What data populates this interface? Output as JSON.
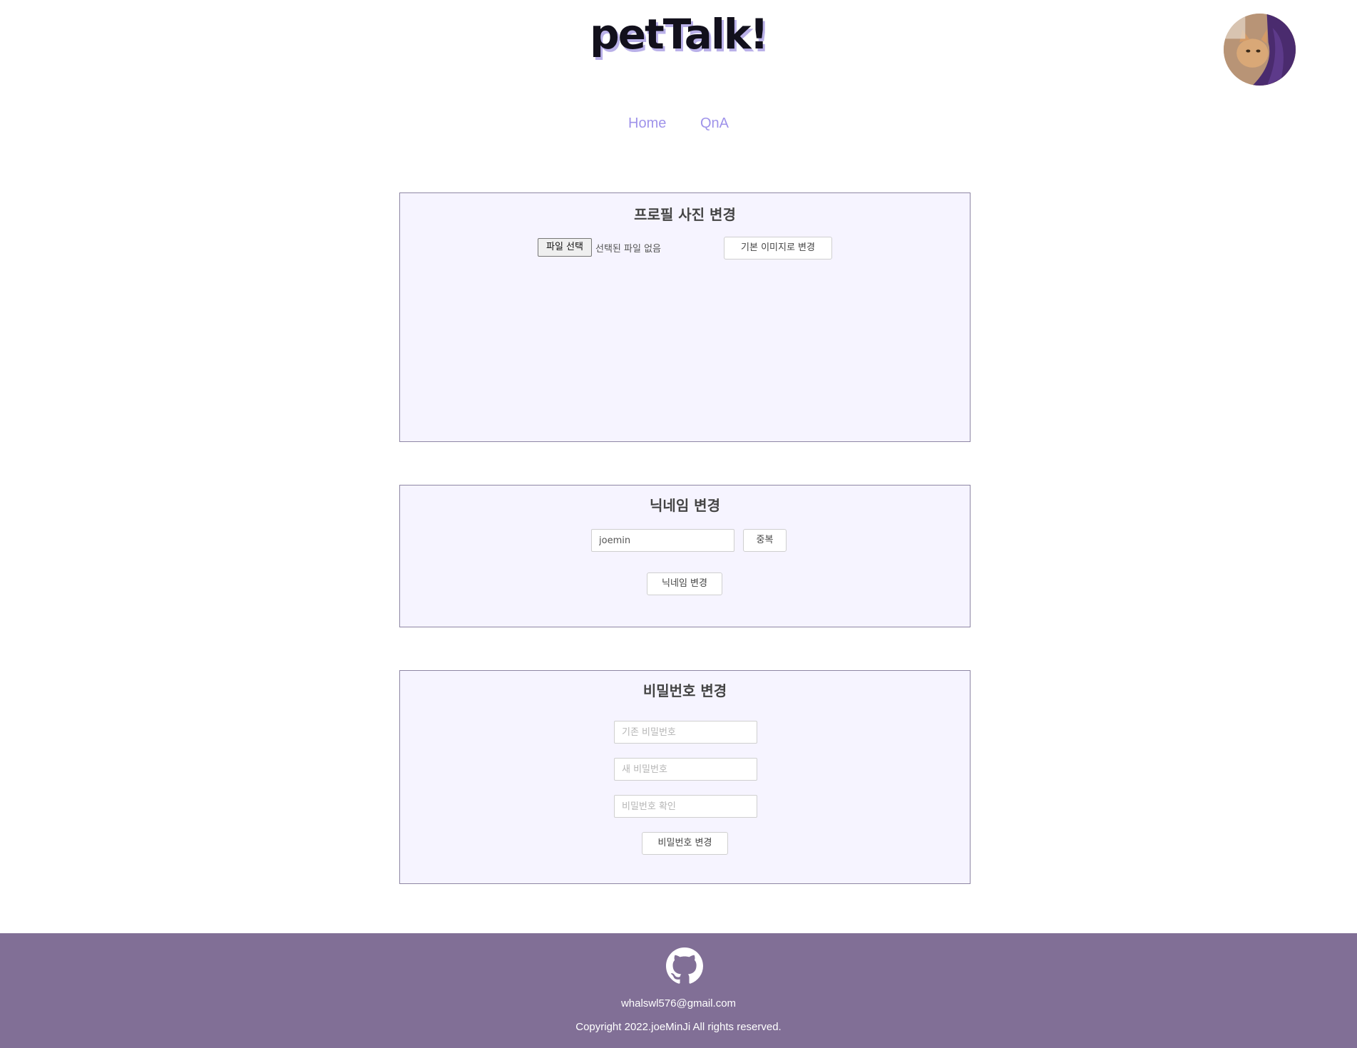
{
  "header": {
    "title": "petTalk!",
    "avatar_alt": "profile-photo"
  },
  "nav": {
    "items": [
      {
        "label": "Home"
      },
      {
        "label": "QnA"
      }
    ]
  },
  "profile_photo": {
    "heading": "프로필 사진 변경",
    "file_button_label": "파일 선택",
    "file_status": "선택된 파일 없음",
    "default_button_label": "기본 이미지로 변경"
  },
  "nickname": {
    "heading": "닉네임 변경",
    "input_value": "joemin",
    "duplicate_button_label": "중복",
    "change_button_label": "닉네임 변경"
  },
  "password": {
    "heading": "비밀번호 변경",
    "current_placeholder": "기존 비밀번호",
    "new_placeholder": "새 비밀번호",
    "confirm_placeholder": "비밀번호 확인",
    "change_button_label": "비밀번호 변경"
  },
  "footer": {
    "email": "whalswl576@gmail.com",
    "copyright": "Copyright 2022.joeMinJi All rights reserved."
  },
  "colors": {
    "accent": "#9f93ea",
    "panel_bg": "#f6f4ff",
    "footer_bg": "#816f96"
  }
}
